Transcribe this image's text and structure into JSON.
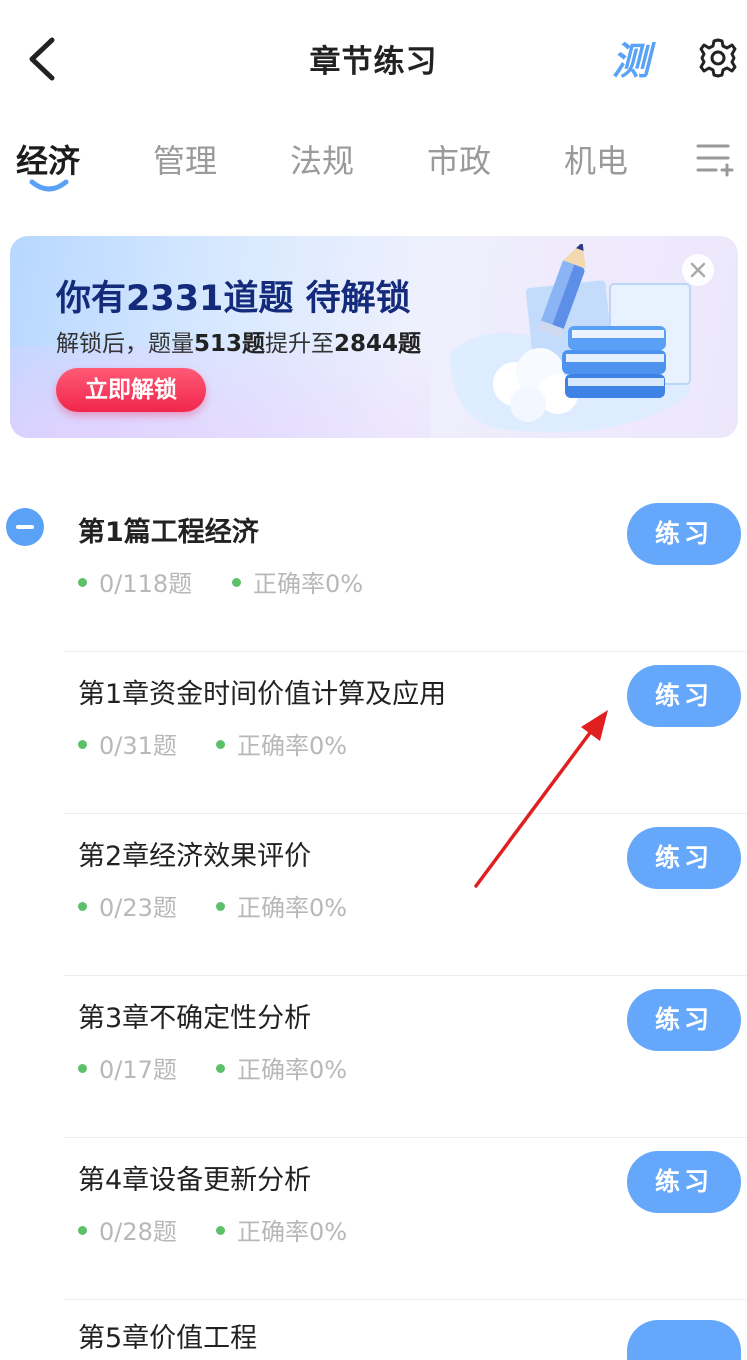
{
  "header": {
    "title": "章节练习",
    "test_label": "测"
  },
  "tabs": [
    "经济",
    "管理",
    "法规",
    "市政",
    "机电"
  ],
  "banner": {
    "heading": "你有2331道题 待解锁",
    "sub_prefix": "解锁后，题量",
    "sub_count": "513题",
    "sub_mid": "提升至",
    "sub_total": "2844题",
    "button": "立即解锁"
  },
  "section": {
    "title": "第1篇工程经济",
    "progress": "0/118题",
    "accuracy": "正确率0%",
    "button": "练习"
  },
  "chapters": [
    {
      "title": "第1章资金时间价值计算及应用",
      "progress": "0/31题",
      "accuracy": "正确率0%",
      "button": "练习"
    },
    {
      "title": "第2章经济效果评价",
      "progress": "0/23题",
      "accuracy": "正确率0%",
      "button": "练习"
    },
    {
      "title": "第3章不确定性分析",
      "progress": "0/17题",
      "accuracy": "正确率0%",
      "button": "练习"
    },
    {
      "title": "第4章设备更新分析",
      "progress": "0/28题",
      "accuracy": "正确率0%",
      "button": "练习"
    }
  ],
  "partial_chapter": {
    "title": "第5章价值工程"
  },
  "colors": {
    "accent": "#5aa2f6",
    "button": "#64a7fb",
    "unlock": "#f1264d",
    "dot": "#5cc06a",
    "arrow": "#e02020"
  }
}
